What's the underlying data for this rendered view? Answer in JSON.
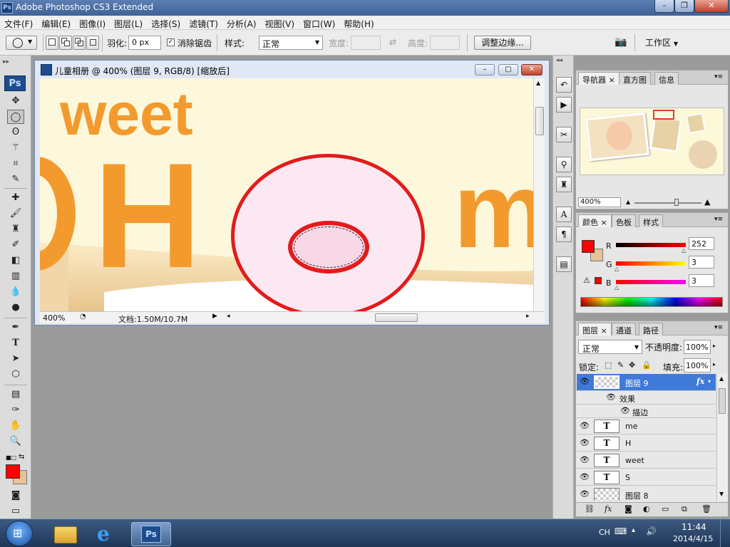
{
  "window": {
    "title": "Adobe Photoshop CS3 Extended",
    "logo": "Ps"
  },
  "menu": [
    "文件(F)",
    "编辑(E)",
    "图像(I)",
    "图层(L)",
    "选择(S)",
    "滤镜(T)",
    "分析(A)",
    "视图(V)",
    "窗口(W)",
    "帮助(H)"
  ],
  "options": {
    "feather_label": "羽化:",
    "feather_value": "0 px",
    "antialias_label": "消除锯齿",
    "style_label": "样式:",
    "style_value": "正常",
    "width_label": "宽度:",
    "height_label": "高度:",
    "refine_button": "调整边缘...",
    "workspace": "工作区"
  },
  "tools": {
    "ps_logo": "Ps"
  },
  "document": {
    "title": "儿童相册 @ 400% (图层 9, RGB/8) [缩放后]",
    "zoom": "400%",
    "doc_info": "文档:1.50M/10.7M",
    "canvas_text_weet": "weet",
    "canvas_text_h": "H",
    "canvas_text_m": "m"
  },
  "navigator": {
    "tabs": [
      "导航器",
      "直方图",
      "信息"
    ],
    "zoom": "400%"
  },
  "color": {
    "tabs": [
      "颜色",
      "色板",
      "样式"
    ],
    "r_label": "R",
    "r_value": "252",
    "g_label": "G",
    "g_value": "3",
    "b_label": "B",
    "b_value": "3",
    "foreground": "#fc0303",
    "background": "#e8c39a"
  },
  "layers": {
    "tabs": [
      "图层",
      "通道",
      "路径"
    ],
    "blend_mode": "正常",
    "opacity_label": "不透明度:",
    "opacity_value": "100%",
    "lock_label": "锁定:",
    "fill_label": "填充:",
    "fill_value": "100%",
    "items": [
      {
        "name": "图层 9",
        "thumb": "",
        "fx": "fx"
      },
      {
        "name": "效果",
        "thumb": ""
      },
      {
        "name": "描边",
        "thumb": ""
      },
      {
        "name": "me",
        "thumb": "T"
      },
      {
        "name": "H",
        "thumb": "T"
      },
      {
        "name": "weet",
        "thumb": "T"
      },
      {
        "name": "S",
        "thumb": "T"
      },
      {
        "name": "图层 8",
        "thumb": ""
      }
    ]
  },
  "taskbar": {
    "lang": "CH",
    "time": "11:44",
    "date": "2014/4/15",
    "ps_label": "Ps"
  }
}
